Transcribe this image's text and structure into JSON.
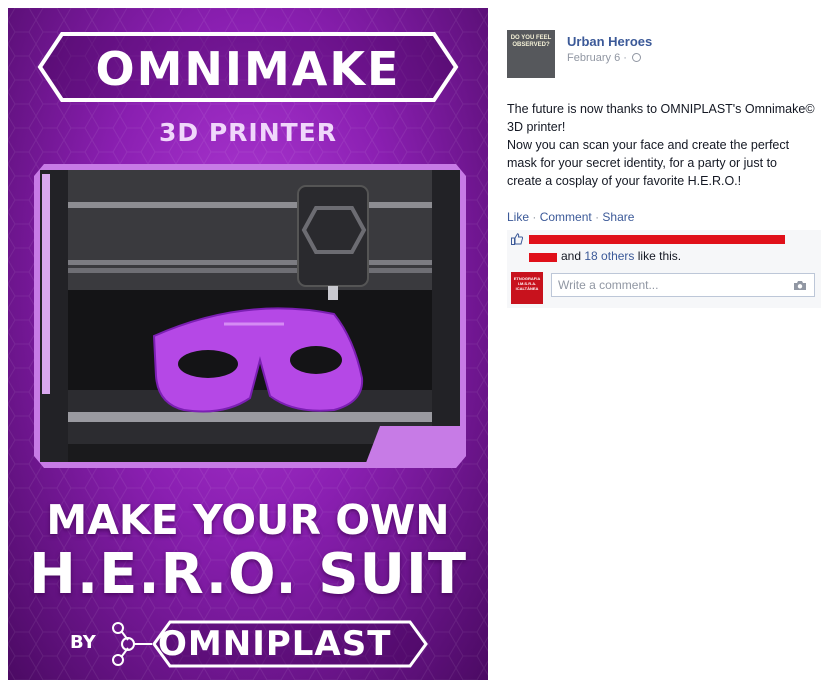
{
  "poster": {
    "logo": "OMNIMAKE",
    "subtitle": "3D PRINTER",
    "headline_line1": "MAKE YOUR OWN",
    "headline_line2": "H.E.R.O. SUIT",
    "by_label": "BY",
    "brand": "OMNIPLAST"
  },
  "post": {
    "avatar_text": "DO YOU FEEL OBSERVED?",
    "page_name": "Urban Heroes",
    "date": "February 6 ·",
    "body_lines": [
      "The future is now thanks to OMNIPLAST's Omnimake©",
      "3D printer!",
      "Now you can scan your face and create the perfect",
      "mask for your secret identity, for a party or just to",
      "create a cosplay of your favorite H.E.R.O.!"
    ],
    "actions": {
      "like": "Like",
      "comment": "Comment",
      "share": "Share",
      "separator": "·"
    },
    "likes": {
      "and_text": "and",
      "others_link": "18 others",
      "suffix": "like this."
    },
    "commenter_avatar_text": "ETNOGRAFIA I.M.S.R.A. ICALTÀNEA",
    "comment_placeholder": "Write a comment..."
  },
  "colors": {
    "link": "#3b5998",
    "poster_purple": "#8a1fb1",
    "redaction": "#e0101a"
  },
  "icons": [
    "globe-icon",
    "like-thumb-icon",
    "camera-icon"
  ]
}
